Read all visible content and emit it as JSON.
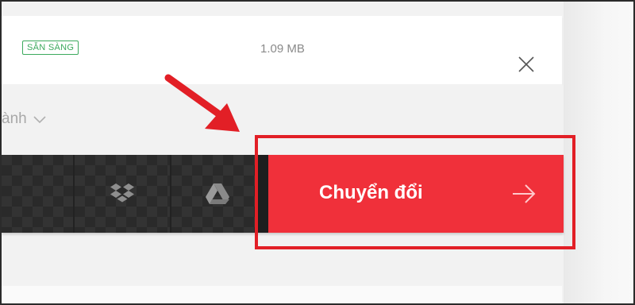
{
  "file": {
    "status": "SẴN SÀNG",
    "size": "1.09 MB"
  },
  "options": {
    "dropdown_label": "ành"
  },
  "toolbar": {
    "dropbox_icon": "dropbox-icon",
    "drive_icon": "google-drive-icon"
  },
  "convert": {
    "label": "Chuyển đổi",
    "arrow_icon": "arrow-right-icon"
  },
  "colors": {
    "accent": "#f0303a",
    "badge": "#3ca95d",
    "annotation": "#e21f26",
    "bar": "#2e2e2e"
  }
}
